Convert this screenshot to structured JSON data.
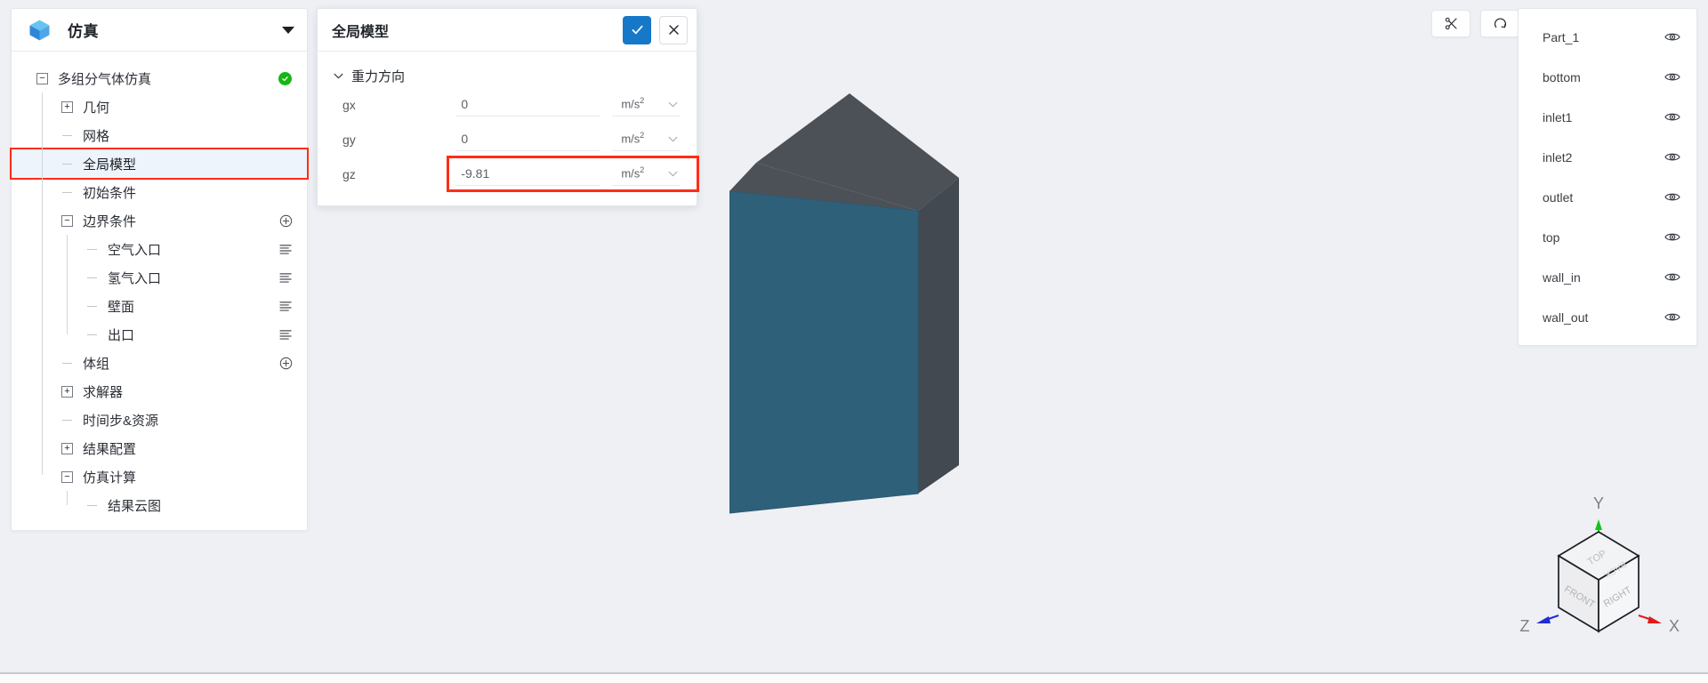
{
  "sidebar": {
    "logo_icon": "cube-icon",
    "title": "仿真",
    "caret_icon": "caret-down-icon",
    "tree": [
      {
        "label": "多组分气体仿真",
        "depth": 0,
        "toggle": "minus",
        "status": "ok"
      },
      {
        "label": "几何",
        "depth": 1,
        "toggle": "plus"
      },
      {
        "label": "网格",
        "depth": 1,
        "toggle": "leaf"
      },
      {
        "label": "全局模型",
        "depth": 1,
        "toggle": "leaf",
        "selected": true
      },
      {
        "label": "初始条件",
        "depth": 1,
        "toggle": "leaf"
      },
      {
        "label": "边界条件",
        "depth": 1,
        "toggle": "minus",
        "action": "add"
      },
      {
        "label": "空气入口",
        "depth": 2,
        "toggle": "leaf",
        "action": "list"
      },
      {
        "label": "氢气入口",
        "depth": 2,
        "toggle": "leaf",
        "action": "list"
      },
      {
        "label": "壁面",
        "depth": 2,
        "toggle": "leaf",
        "action": "list"
      },
      {
        "label": "出口",
        "depth": 2,
        "toggle": "leaf",
        "action": "list"
      },
      {
        "label": "体组",
        "depth": 1,
        "toggle": "leaf",
        "action": "add"
      },
      {
        "label": "求解器",
        "depth": 1,
        "toggle": "plus"
      },
      {
        "label": "时间步&资源",
        "depth": 1,
        "toggle": "leaf"
      },
      {
        "label": "结果配置",
        "depth": 1,
        "toggle": "plus"
      },
      {
        "label": "仿真计算",
        "depth": 1,
        "toggle": "minus"
      },
      {
        "label": "结果云图",
        "depth": 2,
        "toggle": "leaf"
      }
    ]
  },
  "dialog": {
    "title": "全局模型",
    "confirm_icon": "check-icon",
    "cancel_icon": "close-icon",
    "section": {
      "chevron_icon": "chevron-down-icon",
      "label": "重力方向"
    },
    "fields": [
      {
        "label": "gx",
        "value": "0",
        "unit": "m/s",
        "unit_sup": "2",
        "highlighted": false
      },
      {
        "label": "gy",
        "value": "0",
        "unit": "m/s",
        "unit_sup": "2",
        "highlighted": false
      },
      {
        "label": "gz",
        "value": "-9.81",
        "unit": "m/s",
        "unit_sup": "2",
        "highlighted": true
      }
    ]
  },
  "viewport": {
    "toolbar": [
      {
        "icon": "scissors-icon",
        "name": "clip-tool-button"
      },
      {
        "icon": "rotate-icon",
        "name": "reset-view-button"
      }
    ],
    "model": {
      "front_face_color": "#2e5f78",
      "side_face_color": "#4a4f55",
      "top_face_color": "#4a4f55"
    },
    "viewcube": {
      "faces": {
        "top": "TOP",
        "front": "FRONT",
        "right": "RIGHT",
        "back": "BACK"
      },
      "axes": [
        {
          "label": "X",
          "color": "#e01b1b"
        },
        {
          "label": "Y",
          "color": "#15c215"
        },
        {
          "label": "Z",
          "color": "#1f2ed0"
        }
      ]
    }
  },
  "parts_panel": {
    "items": [
      {
        "name": "Part_1",
        "visibility_icon": "eye-icon"
      },
      {
        "name": "bottom",
        "visibility_icon": "eye-icon"
      },
      {
        "name": "inlet1",
        "visibility_icon": "eye-icon"
      },
      {
        "name": "inlet2",
        "visibility_icon": "eye-icon"
      },
      {
        "name": "outlet",
        "visibility_icon": "eye-icon"
      },
      {
        "name": "top",
        "visibility_icon": "eye-icon"
      },
      {
        "name": "wall_in",
        "visibility_icon": "eye-icon"
      },
      {
        "name": "wall_out",
        "visibility_icon": "eye-icon"
      }
    ]
  },
  "colors": {
    "accent": "#1678c8",
    "highlight": "#ff2d16",
    "status_ok": "#16b712",
    "canvas_bg": "#eef0f4"
  }
}
